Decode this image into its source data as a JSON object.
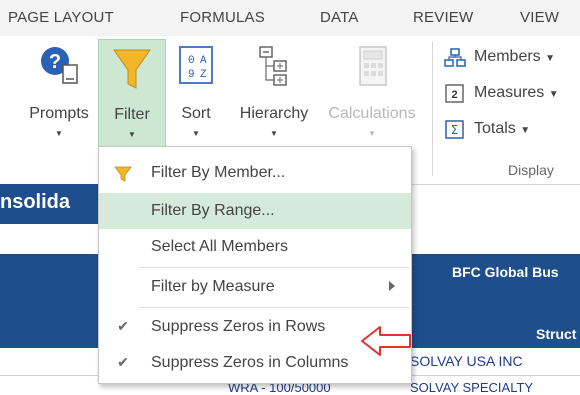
{
  "tabs": [
    "PAGE LAYOUT",
    "FORMULAS",
    "DATA",
    "REVIEW",
    "VIEW"
  ],
  "ribbon": {
    "prompts": "Prompts",
    "filter": "Filter",
    "sort": "Sort",
    "hierarchy": "Hierarchy",
    "calculations": "Calculations",
    "members": "Members",
    "measures": "Measures",
    "totals": "Totals",
    "display_group": "Display"
  },
  "filter_menu": {
    "items": [
      "Filter By Member...",
      "Filter By Range...",
      "Select All Members",
      "Filter by Measure",
      "Suppress Zeros in Rows",
      "Suppress Zeros in Columns"
    ],
    "highlighted_index": 1,
    "checked": [
      false,
      false,
      false,
      false,
      true,
      true
    ]
  },
  "sheet": {
    "title_fragment": "nsolida",
    "header_text": "BFC Global Bus",
    "header_text2": "Struct",
    "row1_text": "SOLVAY USA INC",
    "row2_left": "WRA - 100/50000",
    "row2_right": "SOLVAY SPECIALTY"
  },
  "colors": {
    "accent_green": "#cde8d2",
    "sheet_blue": "#1f4e8c",
    "annotation_red": "#e0332b"
  }
}
